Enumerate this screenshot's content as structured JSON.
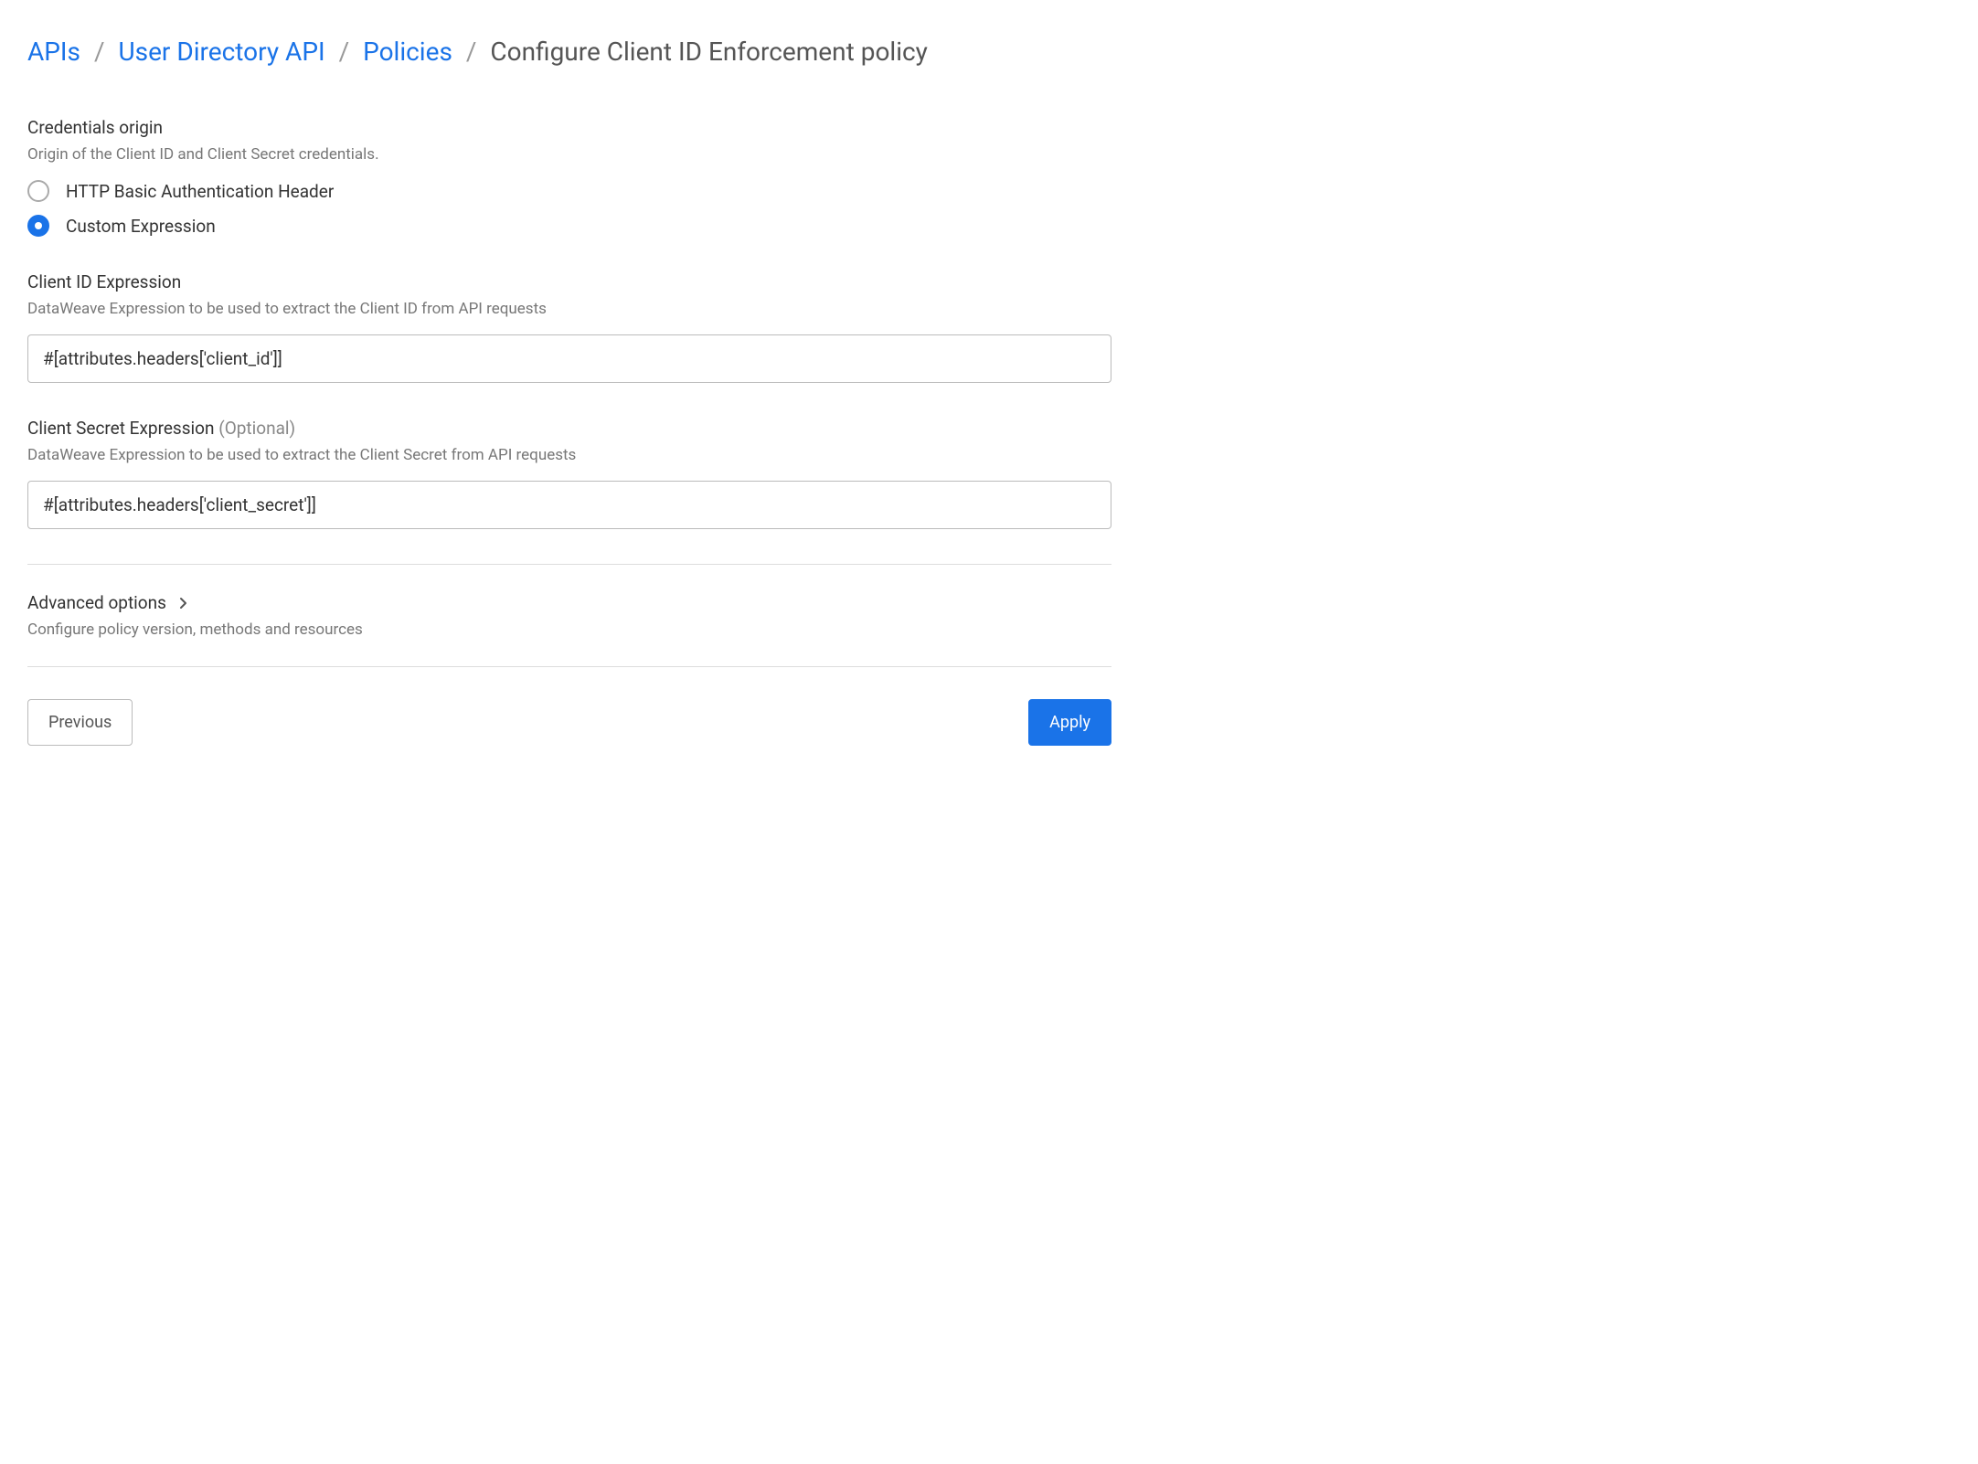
{
  "breadcrumb": {
    "items": [
      {
        "label": "APIs"
      },
      {
        "label": "User Directory API"
      },
      {
        "label": "Policies"
      }
    ],
    "current": "Configure Client ID Enforcement policy"
  },
  "credentials_origin": {
    "label": "Credentials origin",
    "desc": "Origin of the Client ID and Client Secret credentials.",
    "options": [
      {
        "label": "HTTP Basic Authentication Header",
        "selected": false
      },
      {
        "label": "Custom Expression",
        "selected": true
      }
    ]
  },
  "client_id_expr": {
    "label": "Client ID Expression",
    "desc": "DataWeave Expression to be used to extract the Client ID from API requests",
    "value": "#[attributes.headers['client_id']]"
  },
  "client_secret_expr": {
    "label": "Client Secret Expression",
    "optional": "(Optional)",
    "desc": "DataWeave Expression to be used to extract the Client Secret from API requests",
    "value": "#[attributes.headers['client_secret']]"
  },
  "advanced": {
    "label": "Advanced options",
    "desc": "Configure policy version, methods and resources"
  },
  "buttons": {
    "previous": "Previous",
    "apply": "Apply"
  }
}
